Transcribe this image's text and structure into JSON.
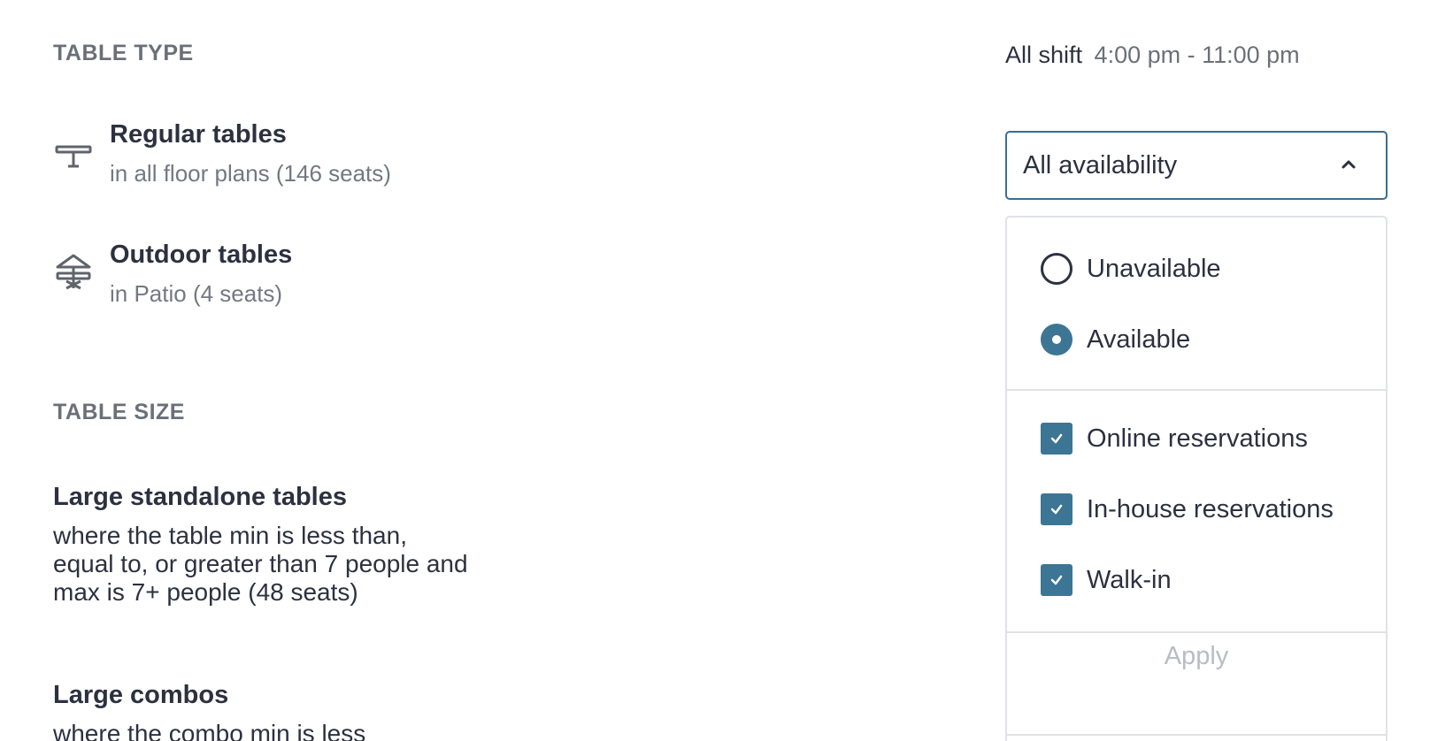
{
  "table_type": {
    "heading": "TABLE TYPE",
    "items": [
      {
        "title": "Regular tables",
        "subtitle": "in all floor plans (146 seats)",
        "icon": "table-icon"
      },
      {
        "title": "Outdoor tables",
        "subtitle": "in Patio (4 seats)",
        "icon": "umbrella-table-icon"
      }
    ]
  },
  "table_size": {
    "heading": "TABLE SIZE",
    "items": [
      {
        "title": "Large standalone tables",
        "description": "where the table min is less than, equal to, or greater than 7 people and max is 7+ people (48 seats)"
      },
      {
        "title": "Large combos",
        "description": "where the combo min is less"
      }
    ]
  },
  "shift": {
    "label": "All shift",
    "time": "4:00 pm - 11:00 pm"
  },
  "availability_select": {
    "value": "All availability",
    "icon": "chevron-up-icon"
  },
  "availability_panel": {
    "radios": [
      {
        "label": "Unavailable",
        "selected": false
      },
      {
        "label": "Available",
        "selected": true
      }
    ],
    "checkboxes": [
      {
        "label": "Online reservations",
        "checked": true
      },
      {
        "label": "In-house reservations",
        "checked": true
      },
      {
        "label": "Walk-in",
        "checked": true
      }
    ],
    "apply_label": "Apply"
  },
  "colors": {
    "accent": "#3d7594",
    "border": "#3a6e8f",
    "text": "#2c3140",
    "muted": "#737883",
    "disabled": "#b8bcc3"
  }
}
